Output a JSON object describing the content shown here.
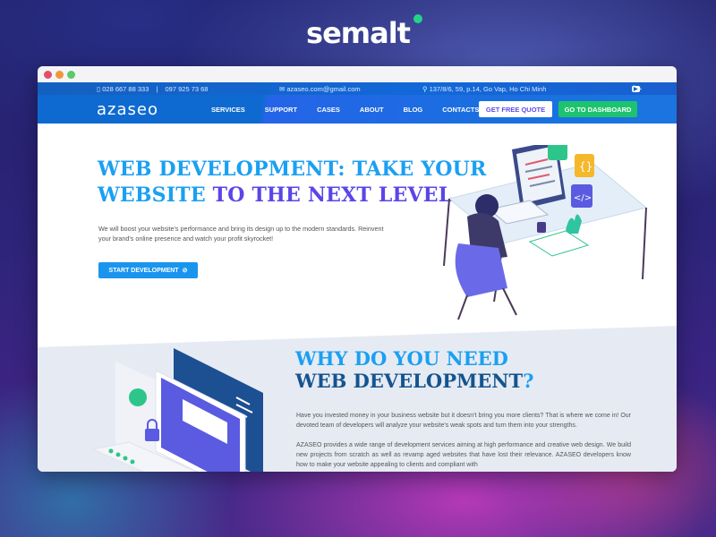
{
  "brand": {
    "name": "semalt"
  },
  "window": {
    "controls": [
      "close",
      "minimize",
      "maximize"
    ]
  },
  "topbar": {
    "phone1": "028 667 88 333",
    "separator": "|",
    "phone2": "097 925 73 68",
    "email": "azaseo.com@gmail.com",
    "address": "137/8/6, 59, p.14, Go Vap, Ho Chi Minh",
    "social": [
      "facebook-icon",
      "twitter-icon",
      "google-plus-icon",
      "youtube-icon"
    ]
  },
  "nav": {
    "logo": "azaseo",
    "items": [
      "SERVICES",
      "SUPPORT",
      "CASES",
      "ABOUT",
      "BLOG",
      "CONTACTS"
    ],
    "quote_button": "GET FREE QUOTE",
    "dashboard_button": "GO TO DASHBOARD"
  },
  "hero": {
    "title_line1": "WEB DEVELOPMENT: TAKE YOUR",
    "title_line2a": "WEBSITE",
    "title_line2b": "TO THE NEXT LEVEL",
    "description": "We will boost your website's performance and bring its design up to the modern standards. Reinvent your brand's online presence and watch your profit skyrocket!",
    "cta": "START DEVELOPMENT"
  },
  "why": {
    "title_line1": "WHY DO YOU NEED",
    "title_line2": "WEB DEVELOPMENT",
    "title_q": "?",
    "para1": "Have you invested money in your business website but it doesn't bring you more clients? That is where we come in! Our devoted team of developers will analyze your website's weak spots and turn them into your strengths.",
    "para2": "AZASEO provides a wide range of development services aiming at high performance and creative web design. We build new projects from scratch as well as revamp aged websites that have lost their relevance. AZASEO developers know how to make your website appealing to clients and compliant with"
  },
  "colors": {
    "primary": "#1ba0f2",
    "accent": "#5a45e8",
    "green": "#1dc36e",
    "navy": "#15548f"
  }
}
